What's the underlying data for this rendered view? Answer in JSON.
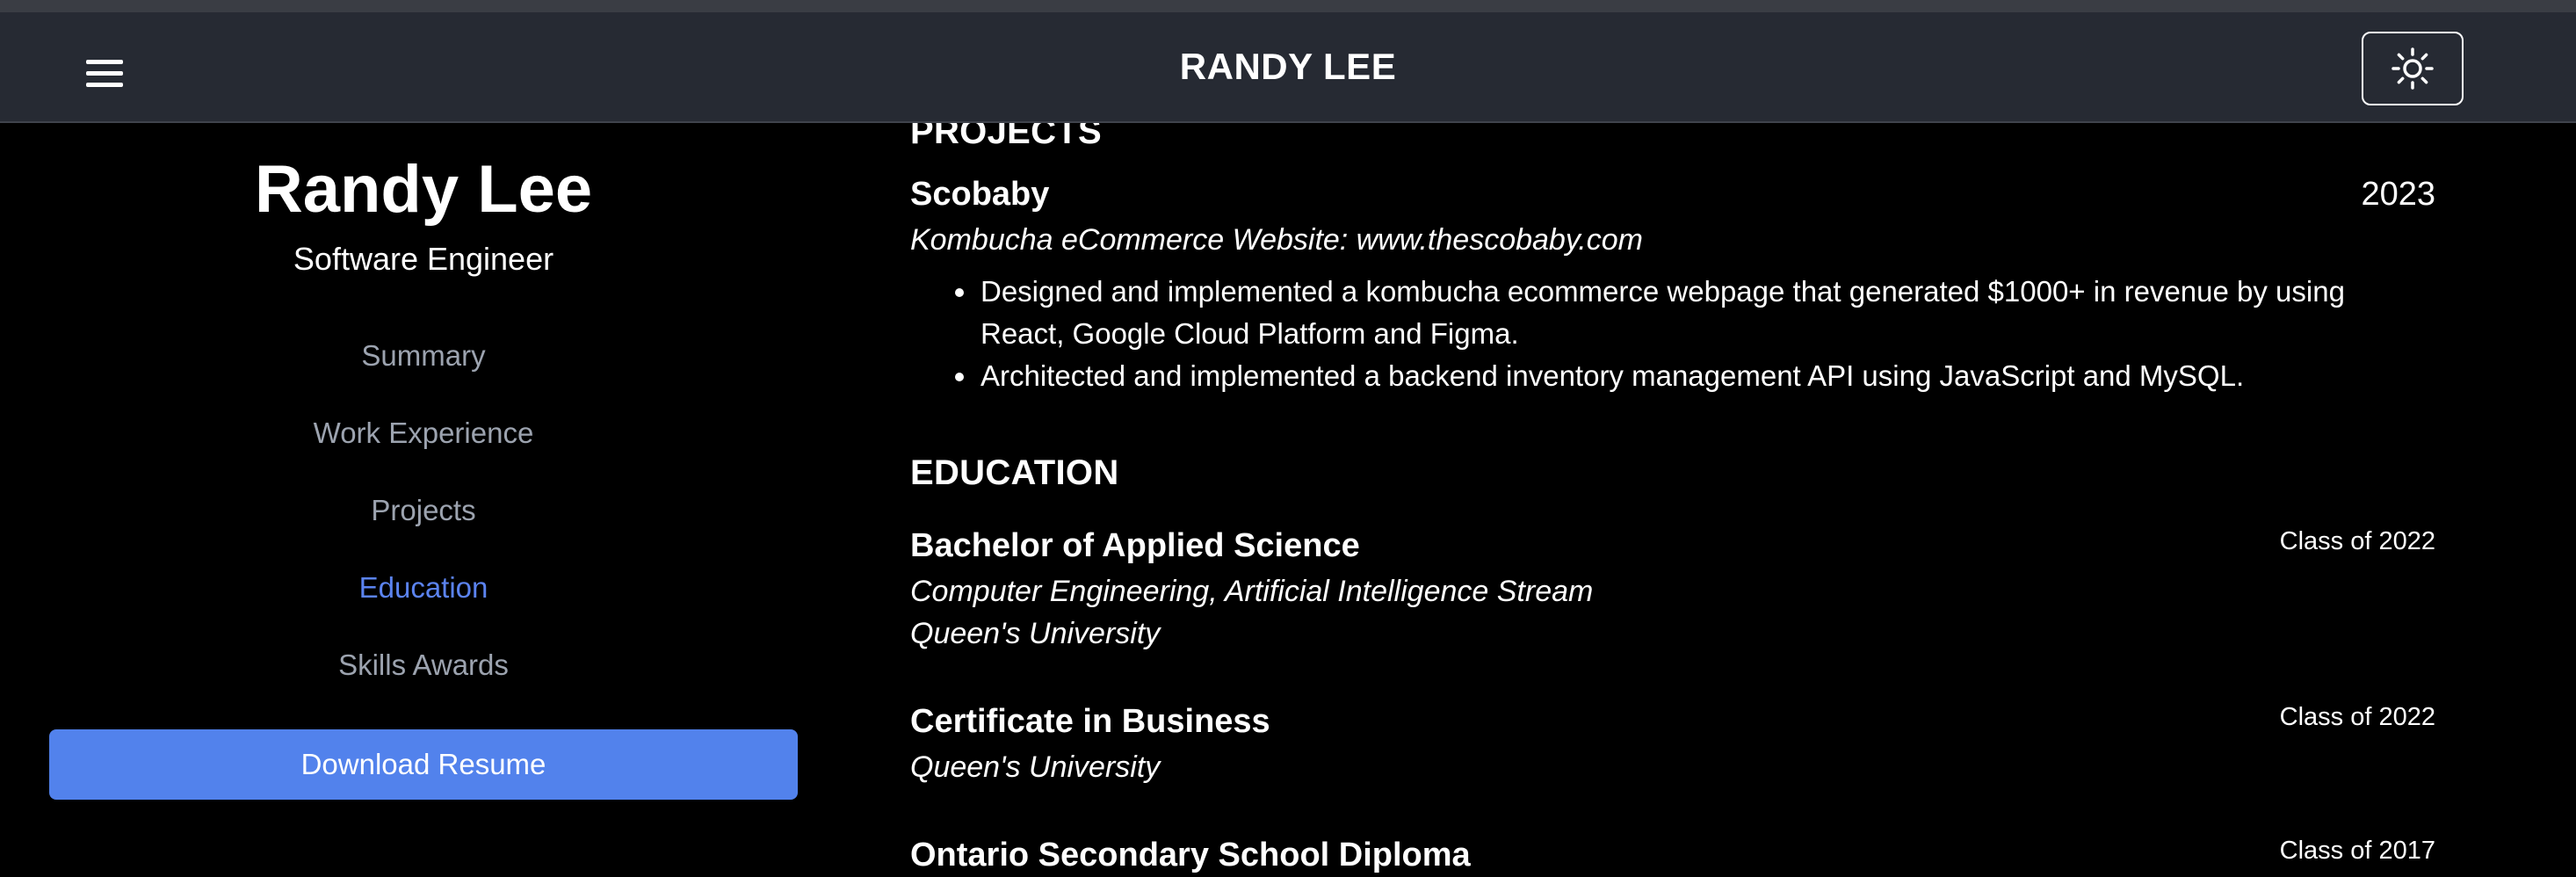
{
  "header": {
    "brand": "RANDY LEE",
    "menu_icon": "hamburger-menu-icon",
    "theme_icon": "sun-icon"
  },
  "sidebar": {
    "name": "Randy Lee",
    "role": "Software Engineer",
    "nav": [
      {
        "label": "Summary",
        "active": false
      },
      {
        "label": "Work Experience",
        "active": false
      },
      {
        "label": "Projects",
        "active": false
      },
      {
        "label": "Education",
        "active": true
      },
      {
        "label": "Skills Awards",
        "active": false
      }
    ],
    "download_label": "Download Resume",
    "accent_color": "#5282ec"
  },
  "projects": {
    "heading": "PROJECTS",
    "items": [
      {
        "title": "Scobaby",
        "year": "2023",
        "subtitle": "Kombucha eCommerce Website: www.thescobaby.com",
        "bullets": [
          "Designed and implemented a kombucha ecommerce webpage that generated $1000+ in revenue by using React, Google Cloud Platform and Figma.",
          "Architected and implemented a backend inventory management API using JavaScript and MySQL."
        ]
      }
    ]
  },
  "education": {
    "heading": "EDUCATION",
    "items": [
      {
        "title": "Bachelor of Applied Science",
        "date": "Class of 2022",
        "lines": [
          "Computer Engineering, Artificial Intelligence Stream",
          "Queen's University"
        ]
      },
      {
        "title": "Certificate in Business",
        "date": "Class of 2022",
        "lines": [
          "Queen's University"
        ]
      },
      {
        "title": "Ontario Secondary School Diploma",
        "date": "Class of 2017",
        "lines": []
      }
    ]
  }
}
